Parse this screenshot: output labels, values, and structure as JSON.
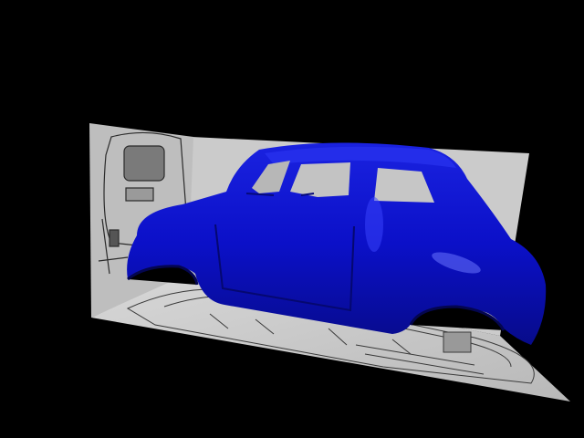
{
  "scene": {
    "background": "#000000",
    "reference_planes": {
      "side_plane_color": "#c9c9c9",
      "back_plane_color": "#bdbdbd",
      "floor_plane_color": "#cfcfcf",
      "sketch_line_color": "#2a2a2a"
    },
    "car_body": {
      "model_icon": "car-body-icon",
      "color": "#0b10c8",
      "shade_color": "#060a7a",
      "highlight_color": "#4a55ff"
    }
  }
}
